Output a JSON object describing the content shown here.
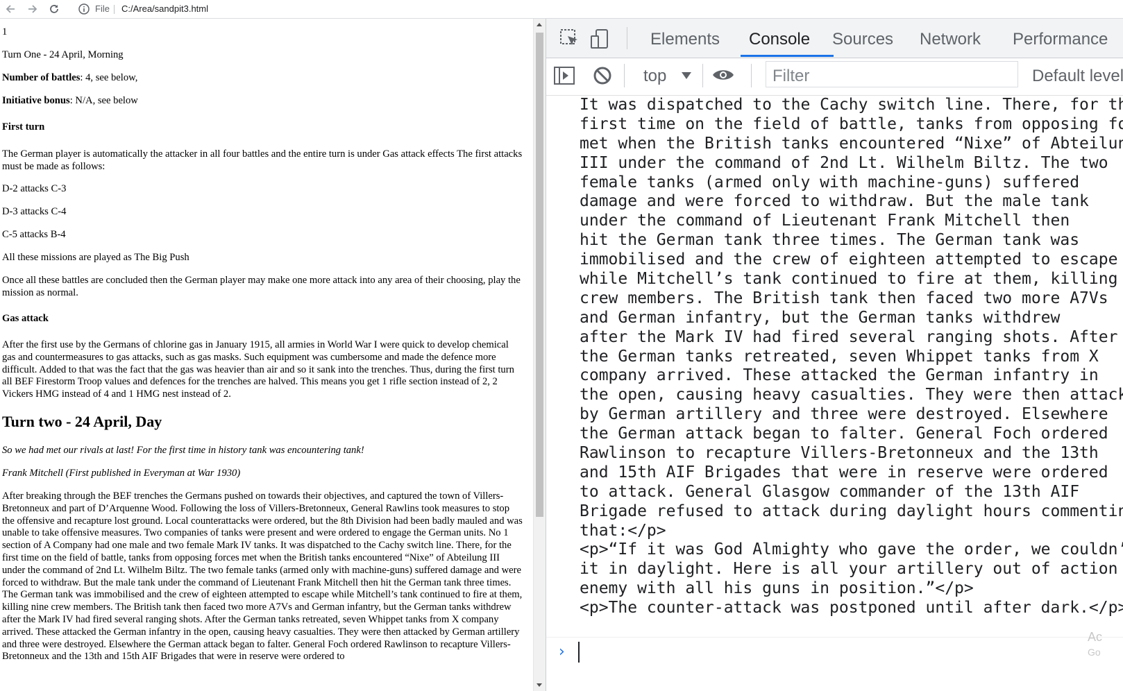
{
  "browser": {
    "scheme": "File",
    "url": "C:/Area/sandpit3.html"
  },
  "page": {
    "page_number": "1",
    "turn_one_title": "Turn One - 24 April, Morning",
    "battles_label": "Number of battles",
    "battles_value": ": 4, see below,",
    "initiative_label": "Initiative bonus",
    "initiative_value": ": N/A, see below",
    "first_turn_heading": "First turn",
    "first_turn_intro": "The German player is automatically the attacker in all four battles and the entire turn is under Gas attack effects The first attacks must be made as follows:",
    "attacks": [
      "D-2 attacks C-3",
      "D-3 attacks C-4",
      "C-5 attacks B-4"
    ],
    "big_push": "All these missions are played as The Big Push",
    "once_all": "Once all these battles are concluded then the German player may make one more attack into any area of their choosing, play the mission as normal.",
    "gas_heading": "Gas attack",
    "gas_text": "After the first use by the Germans of chlorine gas in January 1915, all armies in World War I were quick to develop chemical gas and countermeasures to gas attacks, such as gas masks. Such equipment was cumbersome and made the defence more difficult. Added to that was the fact that the gas was heavier than air and so it sank into the trenches. Thus, during the first turn all BEF Firestorm Troop values and defences for the trenches are halved. This means you get 1 rifle section instead of 2, 2 Vickers HMG instead of 4 and 1 HMG nest instead of 2.",
    "turn_two_heading": "Turn two - 24 April, Day",
    "quote": "So we had met our rivals at last! For the first time in history tank was encountering tank!",
    "quote_source": "Frank Mitchell (First published in Everyman at War 1930)",
    "narrative": "After breaking through the BEF trenches the Germans pushed on towards their objectives, and captured the town of Villers-Bretonneux and part of D’Arquenne Wood. Following the loss of Villers-Bretonneux, General Rawlins took measures to stop the offensive and recapture lost ground. Local counterattacks were ordered, but the 8th Division had been badly mauled and was unable to take offensive measures. Two companies of tanks were present and were ordered to engage the German units. No 1 section of A Company had one male and two female Mark IV tanks. It was dispatched to the Cachy switch line. There, for the first time on the field of battle, tanks from opposing forces met when the British tanks encountered “Nixe” of Abteilung III under the command of 2nd Lt. Wilhelm Biltz. The two female tanks (armed only with machine-guns) suffered damage and were forced to withdraw. But the male tank under the command of Lieutenant Frank Mitchell then hit the German tank three times. The German tank was immobilised and the crew of eighteen attempted to escape while Mitchell’s tank continued to fire at them, killing nine crew members. The British tank then faced two more A7Vs and German infantry, but the German tanks withdrew after the Mark IV had fired several ranging shots. After the German tanks retreated, seven Whippet tanks from X company arrived. These attacked the German infantry in the open, causing heavy casualties. They were then attacked by German artillery and three were destroyed. Elsewhere the German attack began to falter. General Foch ordered Rawlinson to recapture Villers-Bretonneux and the 13th and 15th AIF Brigades that were in reserve were ordered to"
  },
  "devtools": {
    "tabs": [
      "Elements",
      "Console",
      "Sources",
      "Network",
      "Performance"
    ],
    "active_tab": "Console",
    "context": "top",
    "filter_placeholder": "Filter",
    "levels": "Default levels",
    "console_lines": [
      "It was dispatched to the Cachy switch line. There, for the",
      "first time on the field of battle, tanks from opposing force",
      "met when the British tanks encountered “Nixe” of Abteilung",
      "III under the command of 2nd Lt. Wilhelm Biltz. The two",
      "female tanks (armed only with machine-guns) suffered",
      "damage and were forced to withdraw. But the male tank",
      "under the command of Lieutenant Frank Mitchell then",
      "hit the German tank three times. The German tank was",
      "immobilised and the crew of eighteen attempted to escape",
      "while Mitchell’s tank continued to fire at them, killing nin",
      "crew members. The British tank then faced two more A7Vs",
      "and German infantry, but the German tanks withdrew",
      "after the Mark IV had fired several ranging shots. After",
      "the German tanks retreated, seven Whippet tanks from X",
      "company arrived. These attacked the German infantry in",
      "the open, causing heavy casualties. They were then attacked",
      "by German artillery and three were destroyed. Elsewhere",
      "the German attack began to falter. General Foch ordered",
      "Rawlinson to recapture Villers-Bretonneux and the 13th",
      "and 15th AIF Brigades that were in reserve were ordered",
      "to attack. General Glasgow commander of the 13th AIF",
      "Brigade refused to attack during daylight hours commenting",
      "that:</p>",
      "<p>“If it was God Almighty who gave the order, we couldn’t d",
      "it in daylight. Here is all your artillery out of action and",
      "enemy with all his guns in position.”</p>",
      "<p>The counter-attack was postponed until after dark.</p>"
    ],
    "watermark_line1": "Ac",
    "watermark_line2": "Go"
  }
}
